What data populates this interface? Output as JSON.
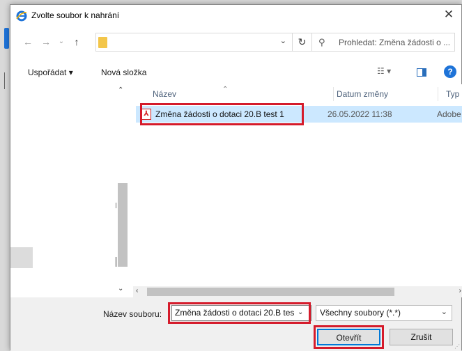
{
  "window": {
    "title": "Zvolte soubor k nahrání",
    "close_symbol": "✕",
    "accent": "#1e73d8",
    "highlight": "#d51b2b"
  },
  "navigation": {
    "back_symbol": "←",
    "forward_symbol": "→",
    "recent_symbol": "⌄",
    "up_symbol": "↑",
    "address_dropdown_symbol": "⌄",
    "refresh_symbol": "↻",
    "search_icon_symbol": "⚲",
    "search_placeholder": "Prohledat: Změna žádosti o ..."
  },
  "toolbar": {
    "organize": "Uspořádat ▾",
    "new_folder": "Nová složka",
    "view_symbol": "☷ ▾",
    "help": "?"
  },
  "columns": {
    "name": "Název",
    "sort_indicator": "⌃",
    "date": "Datum změny",
    "type": "Typ"
  },
  "files": [
    {
      "icon": "pdf-icon",
      "icon_glyph": "⅄",
      "name": "Změna žádosti o dotaci 20.B test 1",
      "date": "26.05.2022 11:38",
      "type": "Adobe"
    }
  ],
  "scroll": {
    "up": "⌃",
    "down": "⌄",
    "left": "‹",
    "right": "›"
  },
  "bottom": {
    "filename_label": "Název souboru:",
    "filename_value": "Změna žádosti o dotaci 20.B tes",
    "filename_dropdown": "⌄",
    "filetype_value": "Všechny soubory (*.*)",
    "filetype_dropdown": "⌄",
    "open_button": "Otevřít",
    "cancel_button": "Zrušit",
    "grip": "⋰"
  }
}
